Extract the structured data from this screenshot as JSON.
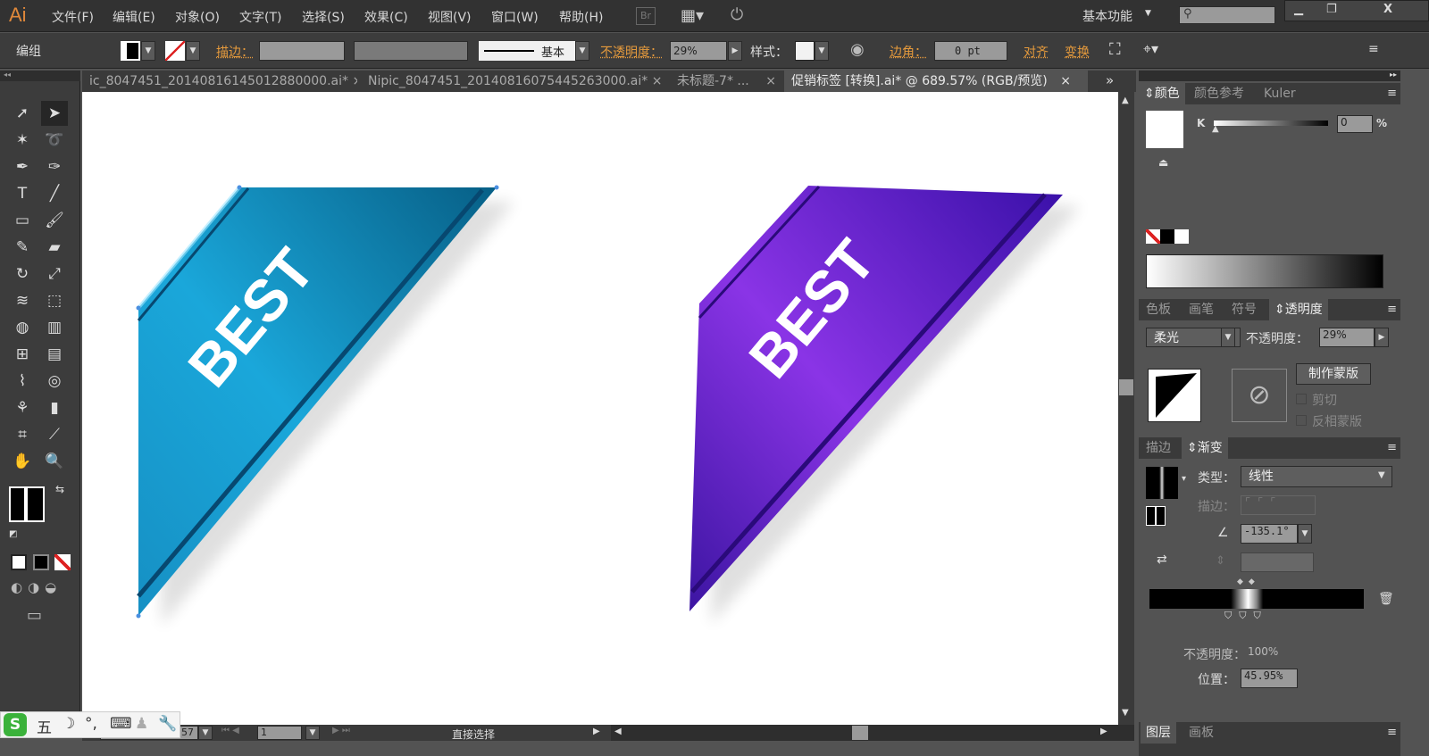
{
  "app": {
    "logo": "Ai",
    "workspace": "基本功能",
    "search_placeholder": ""
  },
  "menu": [
    "文件(F)",
    "编辑(E)",
    "对象(O)",
    "文字(T)",
    "选择(S)",
    "效果(C)",
    "视图(V)",
    "窗口(W)",
    "帮助(H)"
  ],
  "menu_icons": {
    "bridge": "Br"
  },
  "window_controls": {
    "minimize": "▁",
    "restore": "❐",
    "close": "X"
  },
  "control_bar": {
    "selection": "编组",
    "stroke_label": "描边：",
    "stroke_style": "基本",
    "opacity_label": "不透明度：",
    "opacity": "29%",
    "style_label": "样式：",
    "corner_label": "边角：",
    "corner_value": "0 pt",
    "align": "对齐",
    "transform": "变换"
  },
  "tabs": [
    {
      "label": "ic_8047451_20140816145012880000.ai*",
      "close": "×"
    },
    {
      "label": "Nipic_8047451_20140816075445263000.ai*",
      "close": "×"
    },
    {
      "label": "未标题-7* ...",
      "close": "×"
    },
    {
      "label": "促销标签 [转换].ai* @ 689.57% (RGB/预览)",
      "close": "×"
    }
  ],
  "tabs_overflow": "»",
  "canvas": {
    "banners": [
      {
        "text": "BEST",
        "color_start": "#1fa9d6",
        "color_end": "#0a6a93"
      },
      {
        "text": "BEST",
        "color_start": "#8a2fe0",
        "color_end": "#3a109a"
      }
    ]
  },
  "status": {
    "zoom": "689.57",
    "page": "1",
    "tool": "直接选择"
  },
  "ime": {
    "logo": "S",
    "mode": "五"
  },
  "color_panel": {
    "tabs": [
      "颜色",
      "颜色参考",
      "Kuler"
    ],
    "channel": "K",
    "value": "0",
    "unit": "%"
  },
  "transparency_panel": {
    "tabs": [
      "色板",
      "画笔",
      "符号",
      "透明度"
    ],
    "blend_mode": "柔光",
    "opacity_label": "不透明度：",
    "opacity": "29%",
    "make_mask": "制作蒙版",
    "clip": "剪切",
    "invert_mask": "反相蒙版"
  },
  "gradient_panel": {
    "tabs": [
      "描边",
      "渐变"
    ],
    "type_label": "类型：",
    "type": "线性",
    "stroke_label": "描边：",
    "angle": "-135.1°",
    "opacity_label": "不透明度：",
    "opacity": "100%",
    "location_label": "位置：",
    "location": "45.95%"
  },
  "bottom_panel": {
    "tabs": [
      "图层",
      "画板"
    ]
  }
}
